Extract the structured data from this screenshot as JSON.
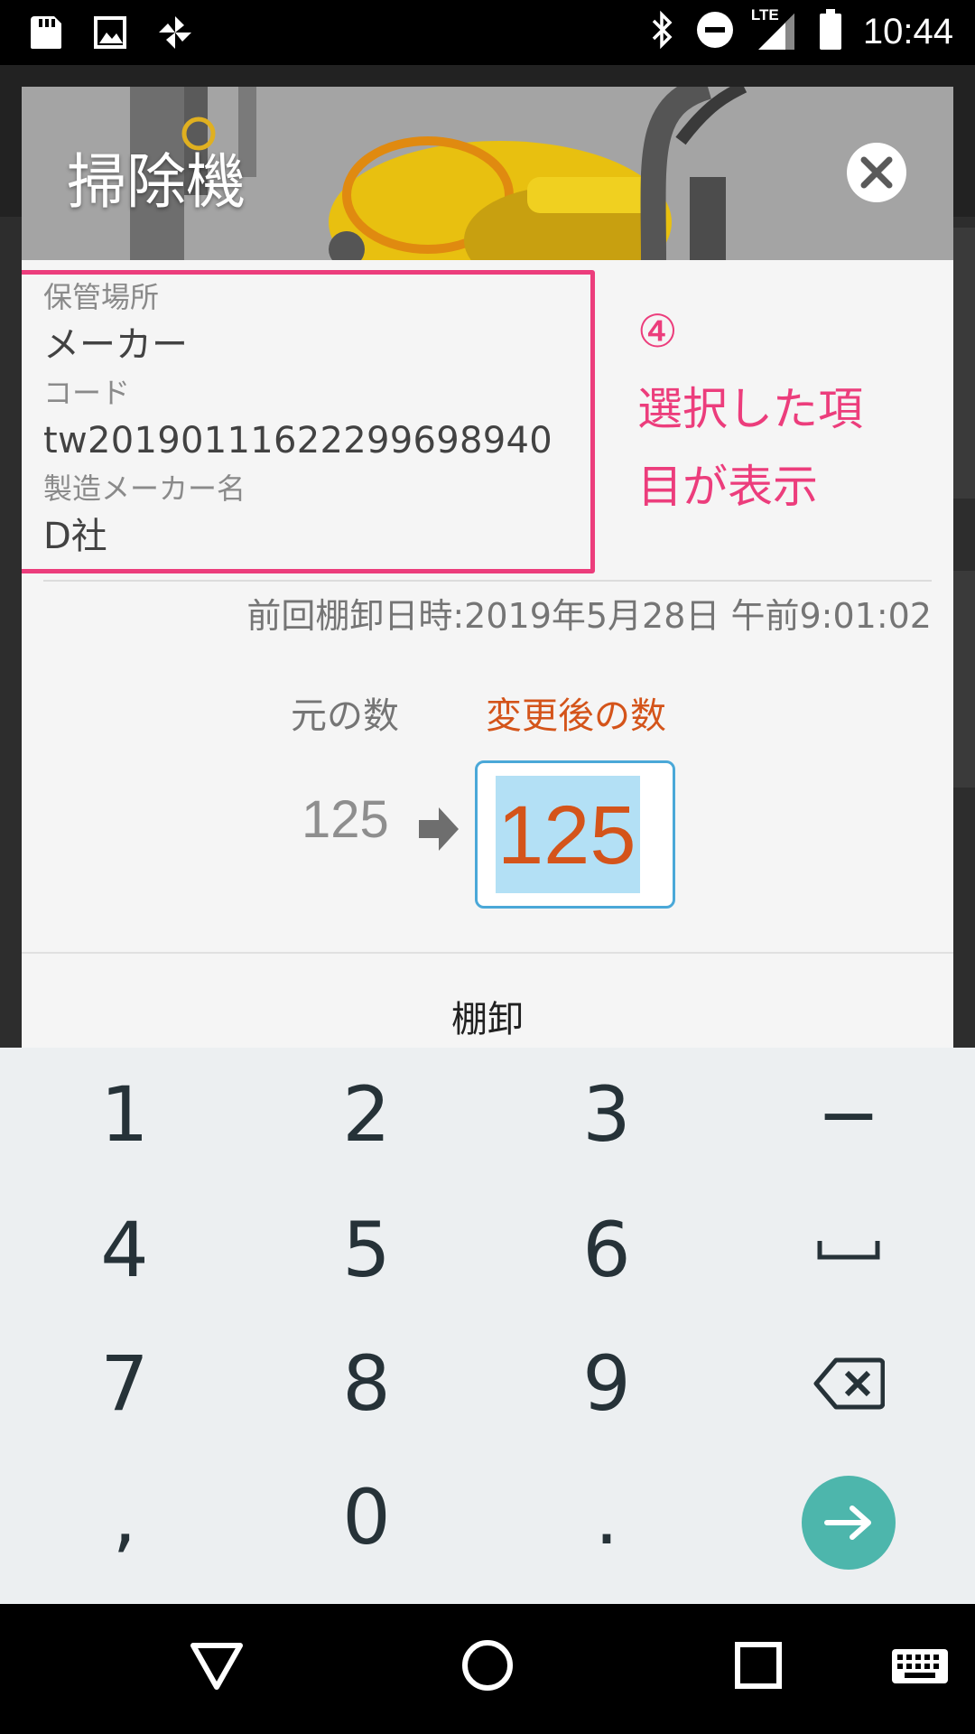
{
  "status_bar": {
    "time": "10:44",
    "network": "LTE",
    "left_icons": [
      "sd-card-icon",
      "image-icon",
      "pinwheel-icon"
    ],
    "right_icons": [
      "bluetooth-icon",
      "do-not-disturb-icon",
      "signal-icon",
      "battery-icon"
    ]
  },
  "dialog": {
    "title": "掃除機",
    "info": {
      "location_label": "保管場所",
      "location_value": "メーカー",
      "code_label": "コード",
      "code_value": "tw20190111622299698940",
      "maker_label": "製造メーカー名",
      "maker_value": "D社"
    },
    "annotation": {
      "number": "④",
      "line1": "選択した項",
      "line2": "目が表示",
      "color": "#ec3d7c"
    },
    "last_inventory": "前回棚卸日時:2019年5月28日 午前9:01:02",
    "original_label": "元の数",
    "new_label": "変更後の数",
    "original_value": "125",
    "new_value": "125",
    "action_label": "棚卸",
    "accent_color": "#d4541a"
  },
  "keyboard": {
    "row1": [
      "1",
      "2",
      "3",
      "−"
    ],
    "row2": [
      "4",
      "5",
      "6",
      "space-icon"
    ],
    "row3": [
      "7",
      "8",
      "9",
      "backspace-icon"
    ],
    "row4": [
      ",",
      "0",
      ".",
      "enter-arrow-icon"
    ],
    "key1": "1",
    "key2": "2",
    "key3": "3",
    "key_minus": "−",
    "key4": "4",
    "key5": "5",
    "key6": "6",
    "key7": "7",
    "key8": "8",
    "key9": "9",
    "key_comma": ",",
    "key0": "0",
    "key_period": ".",
    "go_color": "#4db6ac"
  },
  "nav_bar": {
    "items": [
      "back-icon",
      "home-icon",
      "recents-icon",
      "keyboard-icon"
    ]
  }
}
